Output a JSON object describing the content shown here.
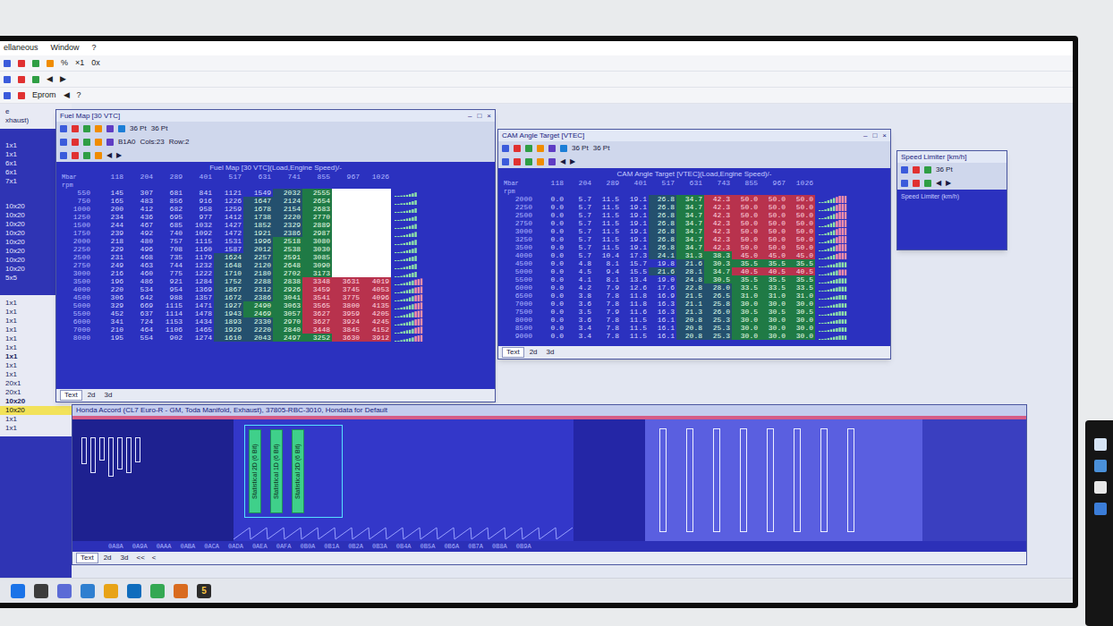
{
  "menu": [
    "ellaneous",
    "Window",
    "?"
  ],
  "toolbar": {
    "rows": [
      [
        "%",
        "×1",
        "0x"
      ],
      [
        "◀",
        "▶"
      ],
      [
        "Eprom",
        "◀",
        "?"
      ]
    ]
  },
  "sidebar": {
    "groups": [
      {
        "kind": "light",
        "items": [
          {
            "label": "e",
            "bold": false,
            "selected": false
          },
          {
            "label": "xhaust)",
            "bold": false,
            "selected": false
          }
        ]
      },
      {
        "kind": "dark",
        "items": [
          {
            "label": "1x1",
            "bold": false,
            "selected": false
          },
          {
            "label": "1x1",
            "bold": false,
            "selected": false
          },
          {
            "label": "6x1",
            "bold": false,
            "selected": false
          },
          {
            "label": "6x1",
            "bold": false,
            "selected": false
          },
          {
            "label": "7x1",
            "bold": false,
            "selected": false
          }
        ]
      },
      {
        "kind": "dark",
        "items": [
          {
            "label": "10x20",
            "bold": false,
            "selected": false
          },
          {
            "label": "10x20",
            "bold": false,
            "selected": false
          },
          {
            "label": "10x20",
            "bold": false,
            "selected": false
          },
          {
            "label": "10x20",
            "bold": false,
            "selected": false
          },
          {
            "label": "10x20",
            "bold": false,
            "selected": false
          },
          {
            "label": "10x20",
            "bold": false,
            "selected": false
          },
          {
            "label": "10x20",
            "bold": false,
            "selected": false
          },
          {
            "label": "10x20",
            "bold": false,
            "selected": false
          },
          {
            "label": "5x5",
            "bold": false,
            "selected": false
          }
        ]
      },
      {
        "kind": "light",
        "items": [
          {
            "label": "1x1",
            "bold": false,
            "selected": false
          },
          {
            "label": "1x1",
            "bold": false,
            "selected": false
          },
          {
            "label": "1x1",
            "bold": false,
            "selected": false
          },
          {
            "label": "1x1",
            "bold": false,
            "selected": false
          },
          {
            "label": "1x1",
            "bold": false,
            "selected": false
          },
          {
            "label": "1x1",
            "bold": false,
            "selected": false
          },
          {
            "label": "1x1",
            "bold": true,
            "selected": false
          },
          {
            "label": "1x1",
            "bold": false,
            "selected": false
          },
          {
            "label": "1x1",
            "bold": false,
            "selected": false
          },
          {
            "label": "20x1",
            "bold": false,
            "selected": false
          },
          {
            "label": "20x1",
            "bold": false,
            "selected": false
          },
          {
            "label": "10x20",
            "bold": true,
            "selected": false
          },
          {
            "label": "10x20",
            "bold": false,
            "selected": true
          },
          {
            "label": "1x1",
            "bold": false,
            "selected": false
          },
          {
            "label": "1x1",
            "bold": false,
            "selected": false
          }
        ]
      }
    ]
  },
  "fuel_window": {
    "title": "Fuel Map [30 VTC]",
    "controls": [
      "–",
      "□",
      "×"
    ],
    "toolbar": [
      [
        "36 Pt",
        "36 Pt"
      ],
      [
        "B1A0",
        "Cols:23",
        "Row:2"
      ],
      [
        "◀",
        "▶"
      ]
    ],
    "heading": "Fuel Map [30 VTC](Load,Engine Speed)/-",
    "corner": [
      "Mbar",
      "rpm"
    ],
    "columns": [
      "118",
      "204",
      "289",
      "401",
      "517",
      "631",
      "741",
      "855",
      "967",
      "1026"
    ],
    "rows": [
      {
        "rpm": "550",
        "values": [
          "145",
          "307",
          "681",
          "841",
          "1121",
          "1549",
          "2032",
          "2555",
          "",
          ""
        ]
      },
      {
        "rpm": "750",
        "values": [
          "165",
          "483",
          "856",
          "916",
          "1226",
          "1647",
          "2124",
          "2654",
          "",
          ""
        ]
      },
      {
        "rpm": "1000",
        "values": [
          "200",
          "412",
          "682",
          "958",
          "1259",
          "1678",
          "2154",
          "2683",
          "",
          ""
        ]
      },
      {
        "rpm": "1250",
        "values": [
          "234",
          "436",
          "695",
          "977",
          "1412",
          "1738",
          "2220",
          "2770",
          "",
          ""
        ]
      },
      {
        "rpm": "1500",
        "values": [
          "244",
          "467",
          "685",
          "1032",
          "1427",
          "1852",
          "2329",
          "2889",
          "",
          ""
        ]
      },
      {
        "rpm": "1750",
        "values": [
          "239",
          "492",
          "740",
          "1092",
          "1472",
          "1921",
          "2386",
          "2987",
          "",
          ""
        ]
      },
      {
        "rpm": "2000",
        "values": [
          "218",
          "480",
          "757",
          "1115",
          "1531",
          "1996",
          "2518",
          "3080",
          "",
          ""
        ]
      },
      {
        "rpm": "2250",
        "values": [
          "229",
          "496",
          "708",
          "1160",
          "1587",
          "2012",
          "2538",
          "3030",
          "",
          ""
        ]
      },
      {
        "rpm": "2500",
        "values": [
          "231",
          "468",
          "735",
          "1179",
          "1624",
          "2257",
          "2591",
          "3085",
          "",
          ""
        ]
      },
      {
        "rpm": "2750",
        "values": [
          "249",
          "463",
          "744",
          "1232",
          "1648",
          "2120",
          "2648",
          "3090",
          "",
          ""
        ]
      },
      {
        "rpm": "3000",
        "values": [
          "216",
          "460",
          "775",
          "1222",
          "1710",
          "2180",
          "2702",
          "3173",
          "",
          ""
        ]
      },
      {
        "rpm": "3500",
        "values": [
          "196",
          "486",
          "921",
          "1284",
          "1752",
          "2288",
          "2838",
          "3348",
          "3631",
          "4019"
        ]
      },
      {
        "rpm": "4000",
        "values": [
          "220",
          "534",
          "954",
          "1369",
          "1867",
          "2312",
          "2926",
          "3459",
          "3745",
          "4053"
        ]
      },
      {
        "rpm": "4500",
        "values": [
          "306",
          "642",
          "988",
          "1357",
          "1672",
          "2386",
          "3041",
          "3541",
          "3775",
          "4096"
        ]
      },
      {
        "rpm": "5000",
        "values": [
          "329",
          "669",
          "1115",
          "1471",
          "1927",
          "2490",
          "3063",
          "3565",
          "3800",
          "4135"
        ]
      },
      {
        "rpm": "5500",
        "values": [
          "452",
          "637",
          "1114",
          "1478",
          "1943",
          "2469",
          "3057",
          "3627",
          "3959",
          "4205"
        ]
      },
      {
        "rpm": "6000",
        "values": [
          "341",
          "724",
          "1153",
          "1434",
          "1893",
          "2330",
          "2970",
          "3627",
          "3924",
          "4245"
        ]
      },
      {
        "rpm": "7000",
        "values": [
          "210",
          "464",
          "1106",
          "1465",
          "1929",
          "2220",
          "2840",
          "3448",
          "3845",
          "4152"
        ]
      },
      {
        "rpm": "8000",
        "values": [
          "195",
          "554",
          "902",
          "1274",
          "1610",
          "2043",
          "2497",
          "3252",
          "3630",
          "3912"
        ]
      }
    ],
    "tabs": [
      {
        "label": "Text",
        "selected": true
      },
      {
        "label": "2d",
        "selected": false
      },
      {
        "label": "3d",
        "selected": false
      }
    ]
  },
  "cam_window": {
    "title": "CAM Angle Target [VTEC]",
    "controls": [
      "–",
      "□",
      "×"
    ],
    "toolbar": [
      [
        "36 Pt",
        "36 Pt"
      ],
      [
        "◀",
        "▶"
      ]
    ],
    "heading": "CAM Angle Target [VTEC](Load,Engine Speed)/-",
    "corner": [
      "Mbar",
      "rpm"
    ],
    "columns": [
      "118",
      "204",
      "289",
      "401",
      "517",
      "631",
      "743",
      "855",
      "967",
      "1026"
    ],
    "rows": [
      {
        "rpm": "2000",
        "values": [
          "0.0",
          "5.7",
          "11.5",
          "19.1",
          "26.8",
          "34.7",
          "42.3",
          "50.0",
          "50.0",
          "50.0"
        ]
      },
      {
        "rpm": "2250",
        "values": [
          "0.0",
          "5.7",
          "11.5",
          "19.1",
          "26.8",
          "34.7",
          "42.3",
          "50.0",
          "50.0",
          "50.0"
        ]
      },
      {
        "rpm": "2500",
        "values": [
          "0.0",
          "5.7",
          "11.5",
          "19.1",
          "26.8",
          "34.7",
          "42.3",
          "50.0",
          "50.0",
          "50.0"
        ]
      },
      {
        "rpm": "2750",
        "values": [
          "0.0",
          "5.7",
          "11.5",
          "19.1",
          "26.8",
          "34.7",
          "42.3",
          "50.0",
          "50.0",
          "50.0"
        ]
      },
      {
        "rpm": "3000",
        "values": [
          "0.0",
          "5.7",
          "11.5",
          "19.1",
          "26.8",
          "34.7",
          "42.3",
          "50.0",
          "50.0",
          "50.0"
        ]
      },
      {
        "rpm": "3250",
        "values": [
          "0.0",
          "5.7",
          "11.5",
          "19.1",
          "26.8",
          "34.7",
          "42.3",
          "50.0",
          "50.0",
          "50.0"
        ]
      },
      {
        "rpm": "3500",
        "values": [
          "0.0",
          "5.7",
          "11.5",
          "19.1",
          "26.8",
          "34.7",
          "42.3",
          "50.0",
          "50.0",
          "50.0"
        ]
      },
      {
        "rpm": "4000",
        "values": [
          "0.0",
          "5.7",
          "10.4",
          "17.3",
          "24.1",
          "31.3",
          "38.3",
          "45.0",
          "45.0",
          "45.0"
        ]
      },
      {
        "rpm": "4500",
        "values": [
          "0.0",
          "4.8",
          "8.1",
          "15.7",
          "19.8",
          "21.6",
          "30.3",
          "35.5",
          "35.5",
          "35.5"
        ]
      },
      {
        "rpm": "5000",
        "values": [
          "0.0",
          "4.5",
          "9.4",
          "15.5",
          "21.6",
          "28.1",
          "34.7",
          "40.5",
          "40.5",
          "40.5"
        ]
      },
      {
        "rpm": "5500",
        "values": [
          "0.0",
          "4.1",
          "8.1",
          "13.4",
          "19.0",
          "24.8",
          "30.5",
          "35.5",
          "35.5",
          "35.5"
        ]
      },
      {
        "rpm": "6000",
        "values": [
          "0.0",
          "4.2",
          "7.9",
          "12.6",
          "17.6",
          "22.8",
          "28.0",
          "33.5",
          "33.5",
          "33.5"
        ]
      },
      {
        "rpm": "6500",
        "values": [
          "0.0",
          "3.8",
          "7.8",
          "11.8",
          "16.9",
          "21.5",
          "26.5",
          "31.0",
          "31.0",
          "31.0"
        ]
      },
      {
        "rpm": "7000",
        "values": [
          "0.0",
          "3.6",
          "7.8",
          "11.8",
          "16.3",
          "21.1",
          "25.8",
          "30.0",
          "30.0",
          "30.0"
        ]
      },
      {
        "rpm": "7500",
        "values": [
          "0.0",
          "3.5",
          "7.9",
          "11.6",
          "16.3",
          "21.3",
          "26.0",
          "30.5",
          "30.5",
          "30.5"
        ]
      },
      {
        "rpm": "8000",
        "values": [
          "0.0",
          "3.6",
          "7.8",
          "11.5",
          "16.1",
          "20.8",
          "25.3",
          "30.0",
          "30.0",
          "30.0"
        ]
      },
      {
        "rpm": "8500",
        "values": [
          "0.0",
          "3.4",
          "7.8",
          "11.5",
          "16.1",
          "20.8",
          "25.3",
          "30.0",
          "30.0",
          "30.0"
        ]
      },
      {
        "rpm": "9000",
        "values": [
          "0.0",
          "3.4",
          "7.8",
          "11.5",
          "16.1",
          "20.8",
          "25.3",
          "30.0",
          "30.0",
          "30.0"
        ]
      }
    ],
    "tabs": [
      {
        "label": "Text",
        "selected": true
      },
      {
        "label": "2d",
        "selected": false
      },
      {
        "label": "3d",
        "selected": false
      }
    ]
  },
  "speed_window": {
    "title": "Speed Limiter [km/h]",
    "toolbar": [
      [
        "36 Pt"
      ],
      [
        "◀",
        "▶"
      ]
    ],
    "label": "Speed Limiter (km/h)"
  },
  "map_panel": {
    "title": "Honda Accord (CL7 Euro-R - GM, Toda Manifold, Exhaust), 37805-RBC-3010, Hondata for Default",
    "labels": [
      "Statistical 2D (6 Bit)",
      "Statistical 1D (6 Bit)",
      "Statistical 2D (6 Bit)"
    ],
    "addresses": [
      "0A8A",
      "0A9A",
      "0AAA",
      "0ABA",
      "0ACA",
      "0ADA",
      "0AEA",
      "0AFA",
      "0B0A",
      "0B1A",
      "0B2A",
      "0B3A",
      "0B4A",
      "0B5A",
      "0B6A",
      "0B7A",
      "0B8A",
      "0B9A"
    ],
    "tabs": [
      {
        "label": "Text",
        "selected": true
      },
      {
        "label": "2d",
        "selected": false
      },
      {
        "label": "3d",
        "selected": false
      }
    ],
    "nav": [
      "<<",
      "<"
    ]
  },
  "taskbar": [
    {
      "label": "",
      "color": "#1a73e8"
    },
    {
      "label": "",
      "color": "#3c3c3c"
    },
    {
      "label": "",
      "color": "#5b6bd6"
    },
    {
      "label": "",
      "color": "#2f7fd0"
    },
    {
      "label": "",
      "color": "#e8a317"
    },
    {
      "label": "",
      "color": "#0f6cbd"
    },
    {
      "label": "",
      "color": "#34a853"
    },
    {
      "label": "",
      "color": "#d96b1f"
    },
    {
      "label": "5",
      "color": "#2b2b2b"
    }
  ]
}
